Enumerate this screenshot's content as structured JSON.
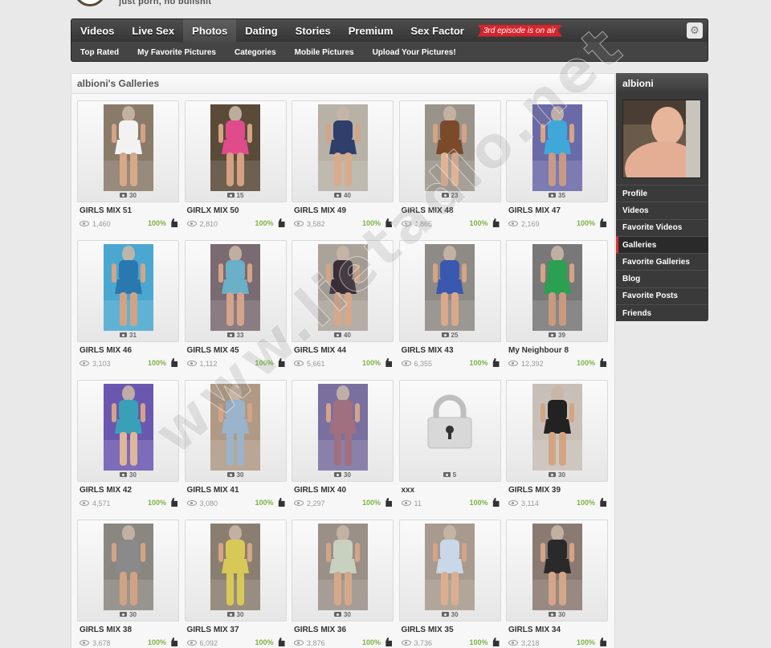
{
  "site": {
    "tagline": "just porn, no bullshit"
  },
  "nav": {
    "tabs": [
      "Videos",
      "Live Sex",
      "Photos",
      "Dating",
      "Stories",
      "Premium",
      "Sex Factor"
    ],
    "active_tab": 2,
    "promo": "3rd episode is on air",
    "subtabs": [
      "Top Rated",
      "My Favorite Pictures",
      "Categories",
      "Mobile Pictures",
      "Upload Your Pictures!"
    ]
  },
  "panel": {
    "title": "albioni's Galleries"
  },
  "galleries": [
    {
      "title": "GIRLS MIX 51",
      "count": "30",
      "views": "1,460",
      "rating": "100%",
      "bg": "#8a7a6a",
      "fg": "#f2f2f2",
      "legs": "#d6a98a"
    },
    {
      "title": "GIRLX MIX 50",
      "count": "15",
      "views": "2,810",
      "rating": "100%",
      "bg": "#5a4a38",
      "fg": "#e04b8c",
      "legs": "#d4a182"
    },
    {
      "title": "GIRLS MIX 49",
      "count": "40",
      "views": "3,582",
      "rating": "100%",
      "bg": "#b7b1a6",
      "fg": "#2f3f6b",
      "legs": "#d9ab8c"
    },
    {
      "title": "GIRLS MIX 48",
      "count": "23",
      "views": "4,865",
      "rating": "100%",
      "bg": "#9a938a",
      "fg": "#7a4a2a",
      "legs": "#e0b395"
    },
    {
      "title": "GIRLS MIX 47",
      "count": "35",
      "views": "2,169",
      "rating": "100%",
      "bg": "#6a6aa8",
      "fg": "#3fa8d8",
      "legs": "#c69a86"
    },
    {
      "title": "GIRLS MIX 46",
      "count": "31",
      "views": "3,103",
      "rating": "100%",
      "bg": "#4aa8d0",
      "fg": "#2a78b0",
      "legs": "#d3a283"
    },
    {
      "title": "GIRLS MIX 45",
      "count": "33",
      "views": "1,112",
      "rating": "100%",
      "bg": "#7a6a72",
      "fg": "#6ab0c8",
      "legs": "#d4a38c"
    },
    {
      "title": "GIRLS MIX 44",
      "count": "40",
      "views": "5,661",
      "rating": "100%",
      "bg": "#aaa39a",
      "fg": "#3a2e36",
      "legs": "#d7a78a"
    },
    {
      "title": "GIRLS MIX 43",
      "count": "25",
      "views": "6,355",
      "rating": "100%",
      "bg": "#8e8a86",
      "fg": "#3a58b0",
      "legs": "#d8a98a"
    },
    {
      "title": "My Neighbour 8",
      "count": "39",
      "views": "12,392",
      "rating": "100%",
      "bg": "#787878",
      "fg": "#2aa050",
      "legs": "#c99a80"
    },
    {
      "title": "GIRLS MIX 42",
      "count": "30",
      "views": "4,571",
      "rating": "100%",
      "bg": "#6a58b0",
      "fg": "#3aa0b8",
      "legs": "#e0b69a"
    },
    {
      "title": "GIRLS MIX 41",
      "count": "30",
      "views": "3,080",
      "rating": "100%",
      "bg": "#b09a86",
      "fg": "#9ab4cc",
      "legs": "#9ab4cc"
    },
    {
      "title": "GIRLS MIX 40",
      "count": "30",
      "views": "2,297",
      "rating": "100%",
      "bg": "#7a70a0",
      "fg": "#a07080",
      "legs": "#a07080"
    },
    {
      "title": "xxx",
      "count": "5",
      "views": "11",
      "rating": "100%",
      "locked": true
    },
    {
      "title": "GIRLS MIX 39",
      "count": "30",
      "views": "3,114",
      "rating": "100%",
      "bg": "#c8c0b8",
      "fg": "#222222",
      "legs": "#d3a484"
    },
    {
      "title": "GIRLS MIX 38",
      "count": "30",
      "views": "3,678",
      "rating": "100%",
      "bg": "#8a8780",
      "fg": "#8a8a8a",
      "legs": "#d0a385"
    },
    {
      "title": "GIRLS MIX 37",
      "count": "30",
      "views": "6,092",
      "rating": "100%",
      "bg": "#8a7e70",
      "fg": "#d8c858",
      "legs": "#d8c858"
    },
    {
      "title": "GIRLS MIX 36",
      "count": "30",
      "views": "3,876",
      "rating": "100%",
      "bg": "#9a9088",
      "fg": "#c8d0c0",
      "legs": "#d6a88a"
    },
    {
      "title": "GIRLS MIX 35",
      "count": "30",
      "views": "3,736",
      "rating": "100%",
      "bg": "#a89a8e",
      "fg": "#c8d8e8",
      "legs": "#dcae90"
    },
    {
      "title": "GIRLS MIX 34",
      "count": "30",
      "views": "3,218",
      "rating": "100%",
      "bg": "#8a7a72",
      "fg": "#2a2a2a",
      "legs": "#d4a587"
    }
  ],
  "sidebar": {
    "username": "albioni",
    "items": [
      "Profile",
      "Videos",
      "Favorite Videos",
      "Galleries",
      "Favorite Galleries",
      "Blog",
      "Favorite Posts",
      "Friends"
    ],
    "active_item": 3
  },
  "watermark": "www.lietadlo.net"
}
